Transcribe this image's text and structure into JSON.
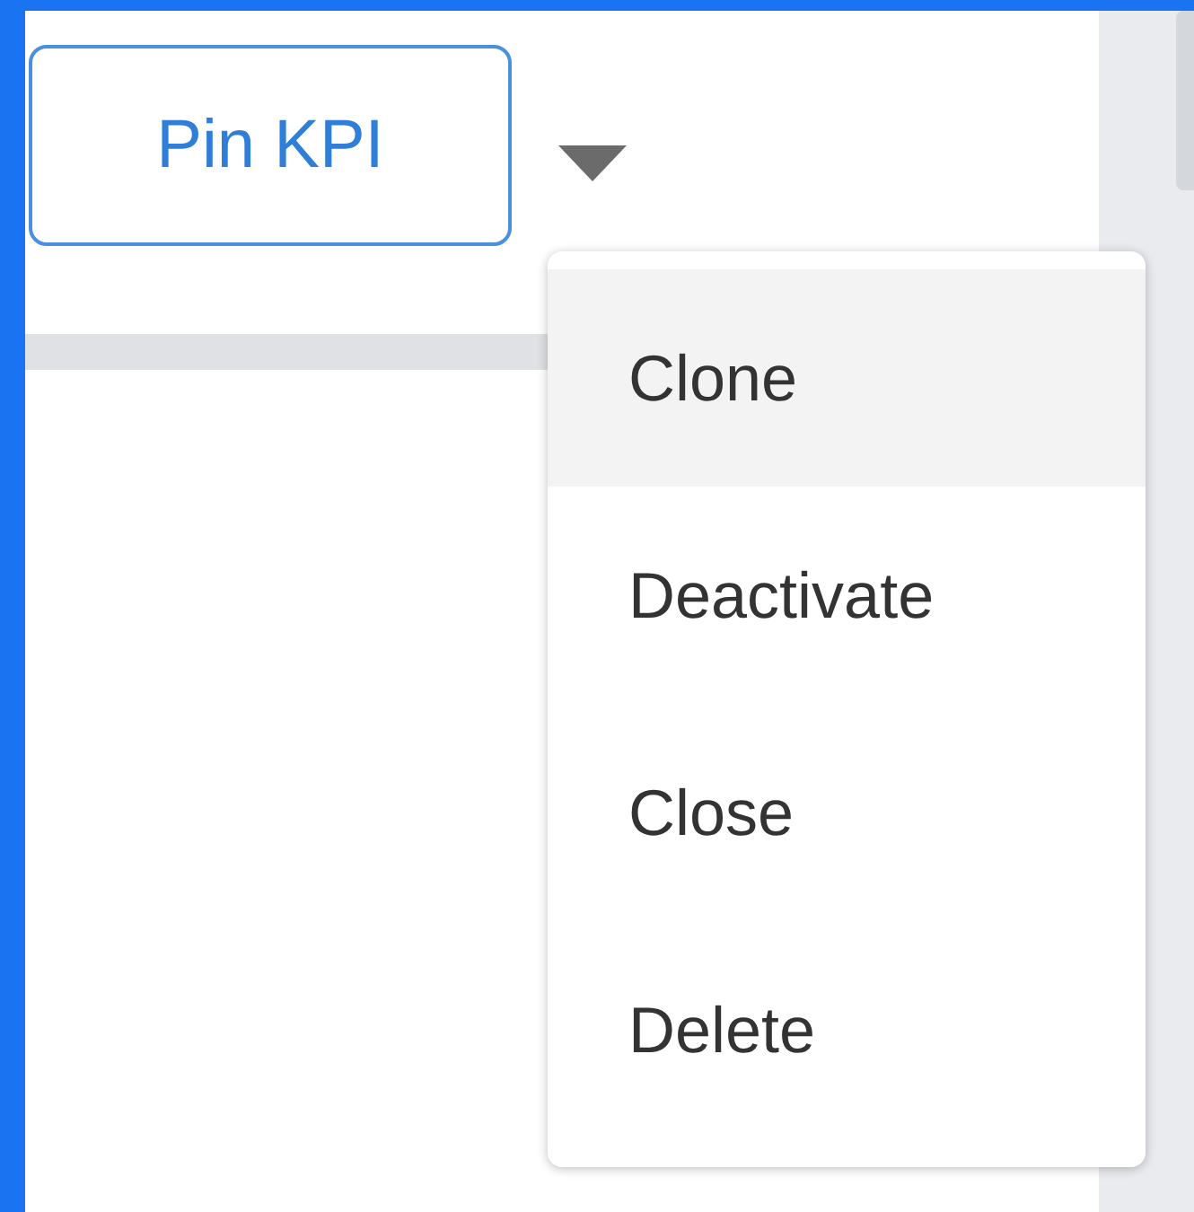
{
  "button": {
    "label": "Pin KPI"
  },
  "menu": {
    "open": true,
    "items": [
      {
        "label": "Clone",
        "highlighted": true
      },
      {
        "label": "Deactivate",
        "highlighted": false
      },
      {
        "label": "Close",
        "highlighted": false
      },
      {
        "label": "Delete",
        "highlighted": false
      }
    ]
  }
}
